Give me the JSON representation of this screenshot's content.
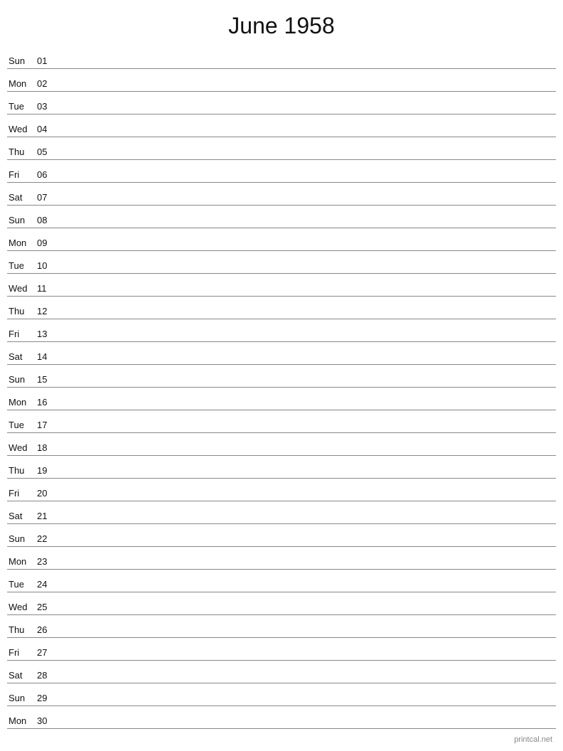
{
  "page": {
    "title": "June 1958"
  },
  "footer": {
    "text": "printcal.net"
  },
  "days": [
    {
      "name": "Sun",
      "number": "01"
    },
    {
      "name": "Mon",
      "number": "02"
    },
    {
      "name": "Tue",
      "number": "03"
    },
    {
      "name": "Wed",
      "number": "04"
    },
    {
      "name": "Thu",
      "number": "05"
    },
    {
      "name": "Fri",
      "number": "06"
    },
    {
      "name": "Sat",
      "number": "07"
    },
    {
      "name": "Sun",
      "number": "08"
    },
    {
      "name": "Mon",
      "number": "09"
    },
    {
      "name": "Tue",
      "number": "10"
    },
    {
      "name": "Wed",
      "number": "11"
    },
    {
      "name": "Thu",
      "number": "12"
    },
    {
      "name": "Fri",
      "number": "13"
    },
    {
      "name": "Sat",
      "number": "14"
    },
    {
      "name": "Sun",
      "number": "15"
    },
    {
      "name": "Mon",
      "number": "16"
    },
    {
      "name": "Tue",
      "number": "17"
    },
    {
      "name": "Wed",
      "number": "18"
    },
    {
      "name": "Thu",
      "number": "19"
    },
    {
      "name": "Fri",
      "number": "20"
    },
    {
      "name": "Sat",
      "number": "21"
    },
    {
      "name": "Sun",
      "number": "22"
    },
    {
      "name": "Mon",
      "number": "23"
    },
    {
      "name": "Tue",
      "number": "24"
    },
    {
      "name": "Wed",
      "number": "25"
    },
    {
      "name": "Thu",
      "number": "26"
    },
    {
      "name": "Fri",
      "number": "27"
    },
    {
      "name": "Sat",
      "number": "28"
    },
    {
      "name": "Sun",
      "number": "29"
    },
    {
      "name": "Mon",
      "number": "30"
    }
  ]
}
